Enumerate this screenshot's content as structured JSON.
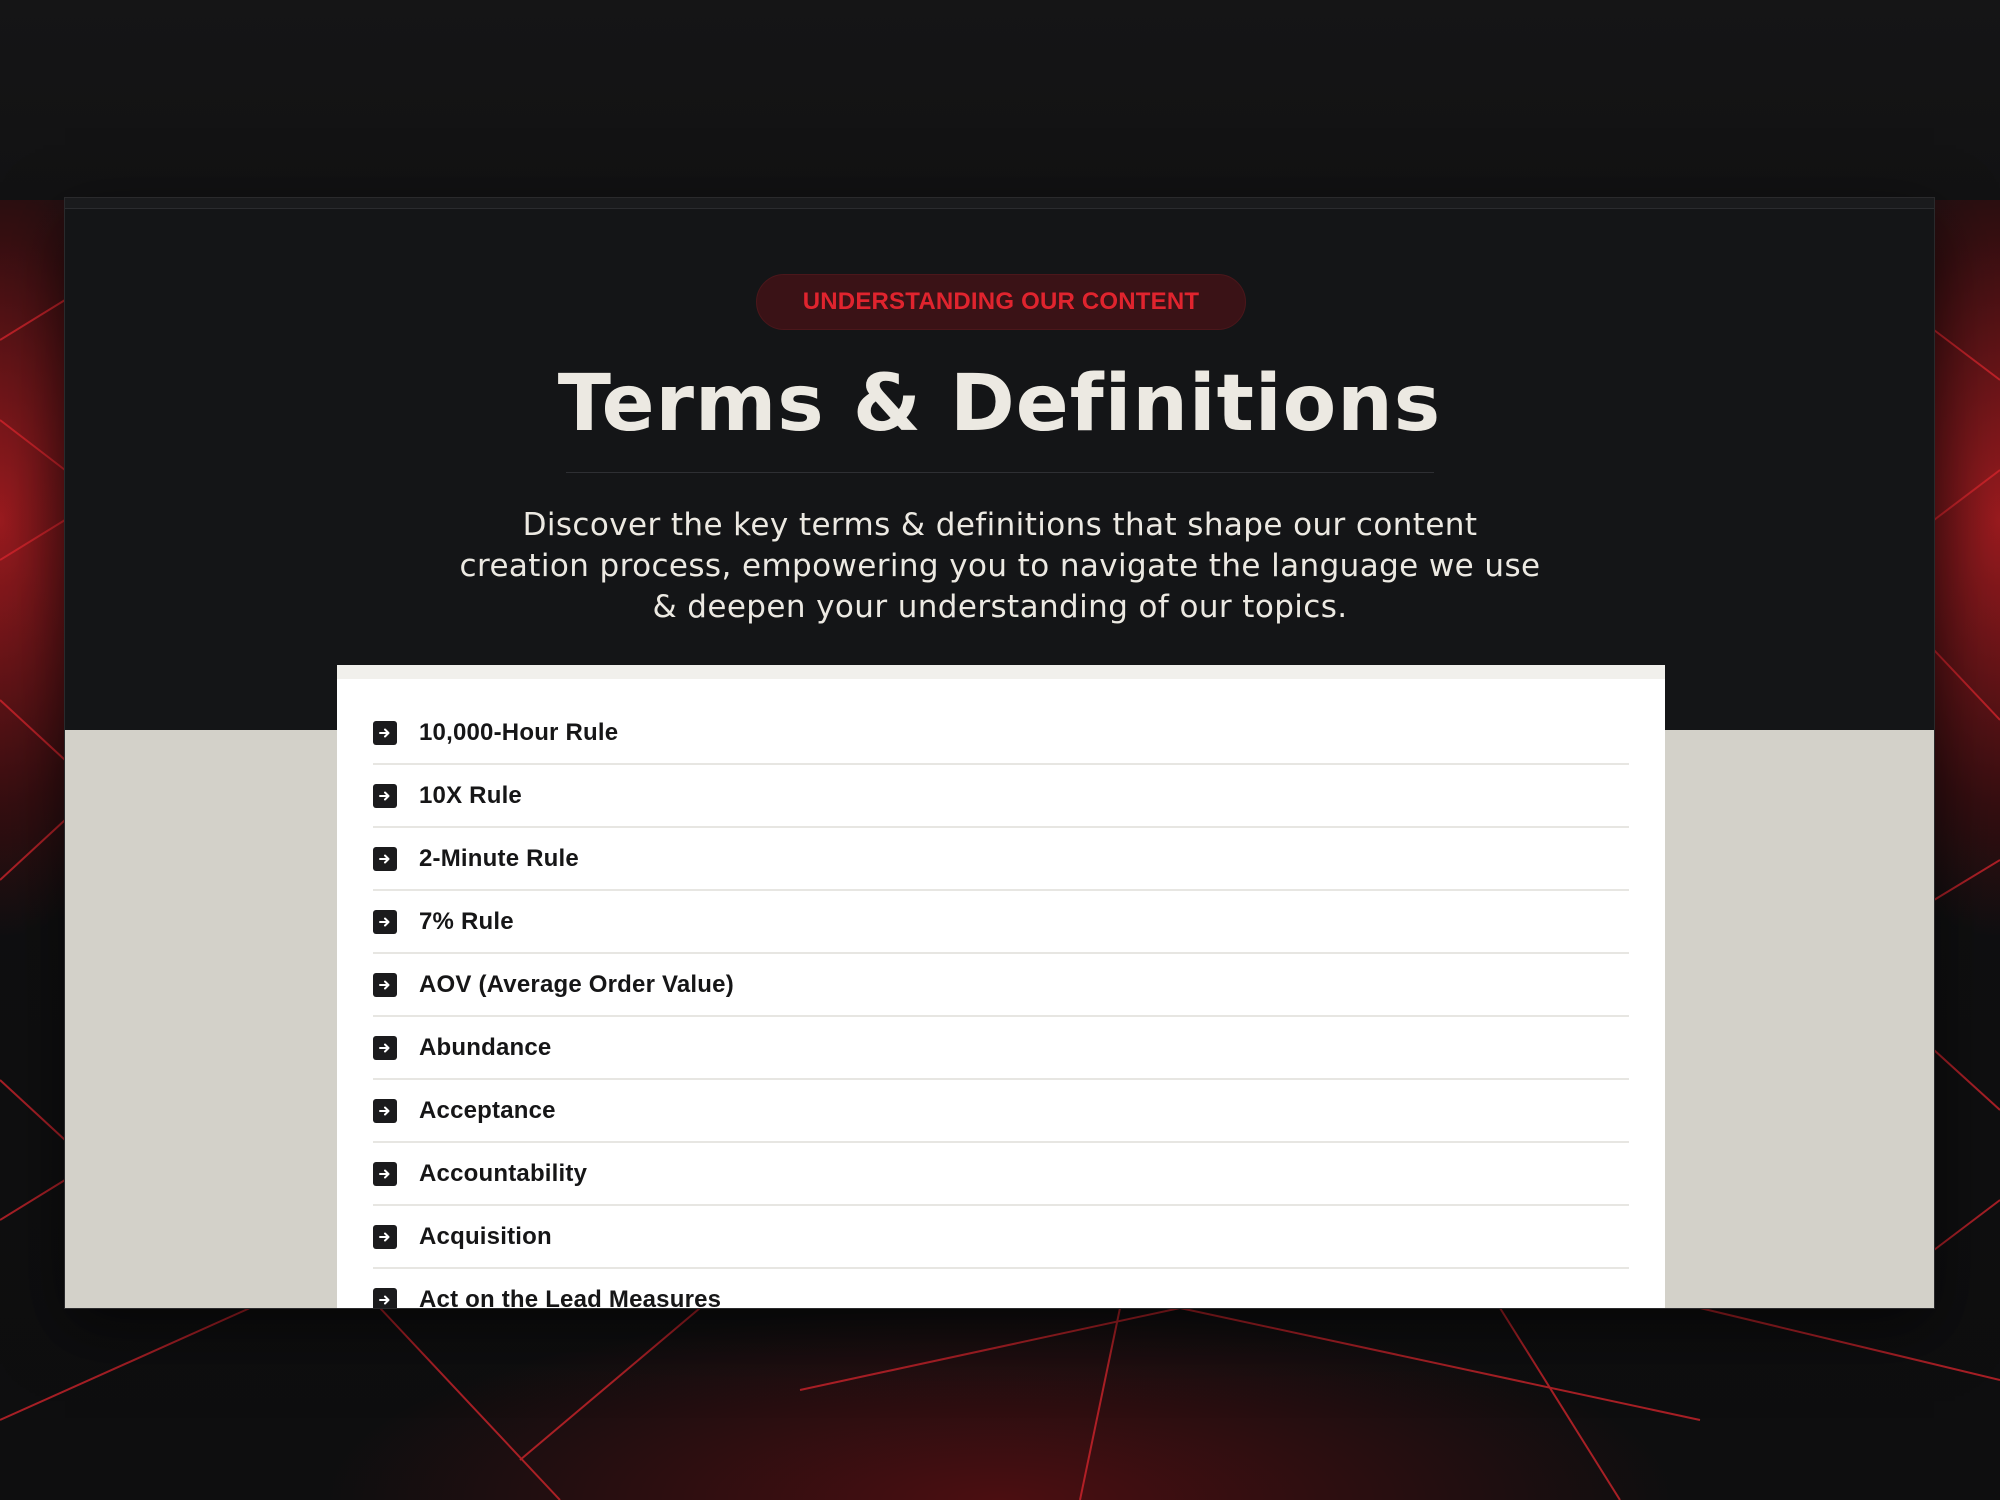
{
  "hero": {
    "eyebrow": "UNDERSTANDING OUR CONTENT",
    "title": "Terms & Definitions",
    "subtitle_lines": [
      "Discover the key terms & definitions that shape our content",
      "creation process, empowering you to navigate the language we use",
      "& deepen your understanding of our topics."
    ]
  },
  "terms": [
    {
      "label": "10,000-Hour Rule",
      "icon": "arrow-right-square-icon"
    },
    {
      "label": "10X Rule",
      "icon": "arrow-right-square-icon"
    },
    {
      "label": "2-Minute Rule",
      "icon": "arrow-right-square-icon"
    },
    {
      "label": "7% Rule",
      "icon": "arrow-right-square-icon"
    },
    {
      "label": "AOV (Average Order Value)",
      "icon": "arrow-right-square-icon"
    },
    {
      "label": "Abundance",
      "icon": "arrow-right-square-icon"
    },
    {
      "label": "Acceptance",
      "icon": "arrow-right-square-icon"
    },
    {
      "label": "Accountability",
      "icon": "arrow-right-square-icon"
    },
    {
      "label": "Acquisition",
      "icon": "arrow-right-square-icon"
    },
    {
      "label": "Act on the Lead Measures",
      "icon": "arrow-right-square-icon"
    }
  ],
  "colors": {
    "accent": "#e0242e",
    "hero_bg": "#141517",
    "page_bg": "#d3d1c9",
    "panel_bg": "#ffffff",
    "text_dark": "#161617",
    "text_light": "#ece9e2"
  }
}
